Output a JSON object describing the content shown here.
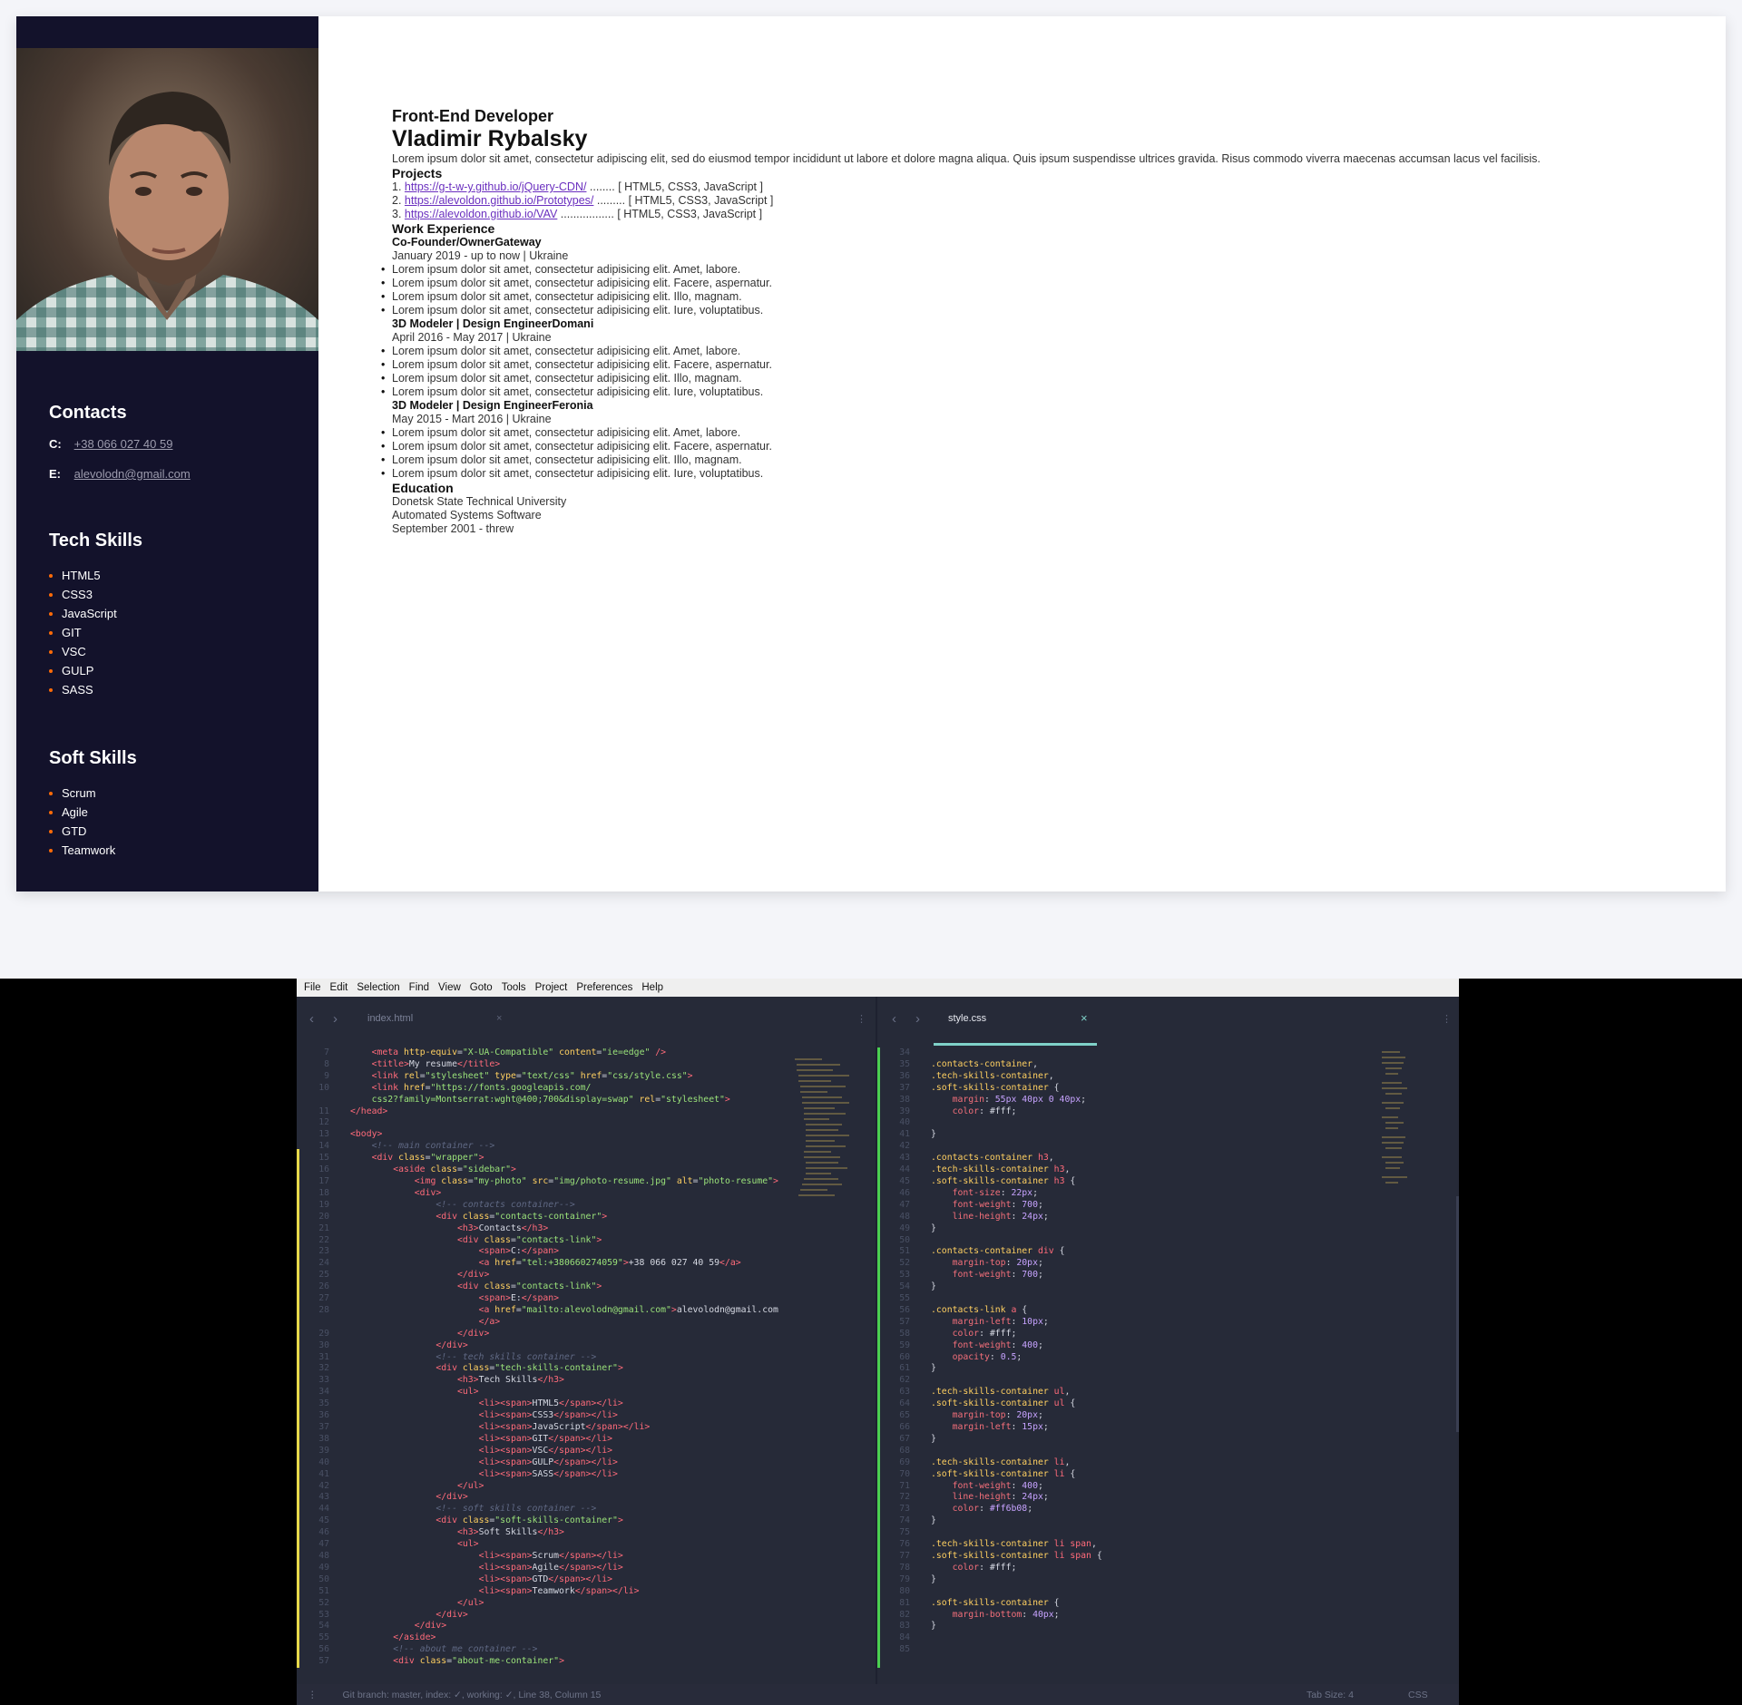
{
  "sidebar": {
    "contacts_title": "Contacts",
    "contacts": [
      {
        "label": "C:",
        "value": "+38 066 027 40 59"
      },
      {
        "label": "E:",
        "value": "alevolodn@gmail.com"
      }
    ],
    "tech_title": "Tech Skills",
    "tech_skills": [
      "HTML5",
      "CSS3",
      "JavaScript",
      "GIT",
      "VSC",
      "GULP",
      "SASS"
    ],
    "soft_title": "Soft Skills",
    "soft_skills": [
      "Scrum",
      "Agile",
      "GTD",
      "Teamwork"
    ],
    "accent": "#ff6b08",
    "bg": "#13122b"
  },
  "main": {
    "role": "Front-End Developer",
    "name": "Vladimir Rybalsky",
    "intro": "Lorem ipsum dolor sit amet, consectetur adipiscing elit, sed do eiusmod tempor incididunt ut labore et dolore magna aliqua. Quis ipsum suspendisse ultrices gravida. Risus commodo viverra maecenas accumsan lacus vel facilisis.",
    "projects_title": "Projects",
    "projects": [
      {
        "num": "1.",
        "url": "https://g-t-w-y.github.io/jQuery-CDN/",
        "dots": " ........ ",
        "tech": "[ HTML5, CSS3, JavaScript ]"
      },
      {
        "num": "2.",
        "url": "https://alevoldon.github.io/Prototypes/",
        "dots": " ......... ",
        "tech": "[ HTML5, CSS3, JavaScript ]"
      },
      {
        "num": "3.",
        "url": "https://alevoldon.github.io/VAV",
        "dots": " ................. ",
        "tech": "[ HTML5, CSS3, JavaScript ]"
      }
    ],
    "work_title": "Work Experience",
    "jobs": [
      {
        "title": "Co-Founder/OwnerGateway",
        "period": "January 2019 - up to now | Ukraine",
        "items": [
          "Lorem ipsum dolor sit amet, consectetur adipisicing elit. Amet, labore.",
          "Lorem ipsum dolor sit amet, consectetur adipisicing elit. Facere, aspernatur.",
          "Lorem ipsum dolor sit amet, consectetur adipisicing elit. Illo, magnam.",
          "Lorem ipsum dolor sit amet, consectetur adipisicing elit. Iure, voluptatibus."
        ]
      },
      {
        "title": "3D Modeler | Design EngineerDomani",
        "period": "April 2016 - May 2017 | Ukraine",
        "items": [
          "Lorem ipsum dolor sit amet, consectetur adipisicing elit. Amet, labore.",
          "Lorem ipsum dolor sit amet, consectetur adipisicing elit. Facere, aspernatur.",
          "Lorem ipsum dolor sit amet, consectetur adipisicing elit. Illo, magnam.",
          "Lorem ipsum dolor sit amet, consectetur adipisicing elit. Iure, voluptatibus."
        ]
      },
      {
        "title": "3D Modeler | Design EngineerFeronia",
        "period": "May 2015 - Mart 2016 | Ukraine",
        "items": [
          "Lorem ipsum dolor sit amet, consectetur adipisicing elit. Amet, labore.",
          "Lorem ipsum dolor sit amet, consectetur adipisicing elit. Facere, aspernatur.",
          "Lorem ipsum dolor sit amet, consectetur adipisicing elit. Illo, magnam.",
          "Lorem ipsum dolor sit amet, consectetur adipisicing elit. Iure, voluptatibus."
        ]
      }
    ],
    "education_title": "Education",
    "education": [
      "Donetsk State Technical University",
      "Automated Systems Software",
      "September 2001 - threw"
    ]
  },
  "editor": {
    "menu": [
      "File",
      "Edit",
      "Selection",
      "Find",
      "View",
      "Goto",
      "Tools",
      "Project",
      "Preferences",
      "Help"
    ],
    "left_tab": "index.html",
    "right_tab": "style.css",
    "close_glyph": "×",
    "status": "Git branch: master, index: ✓, working: ✓, Line 38, Column 15",
    "tab_size": "Tab Size: 4",
    "syntax": "CSS"
  }
}
